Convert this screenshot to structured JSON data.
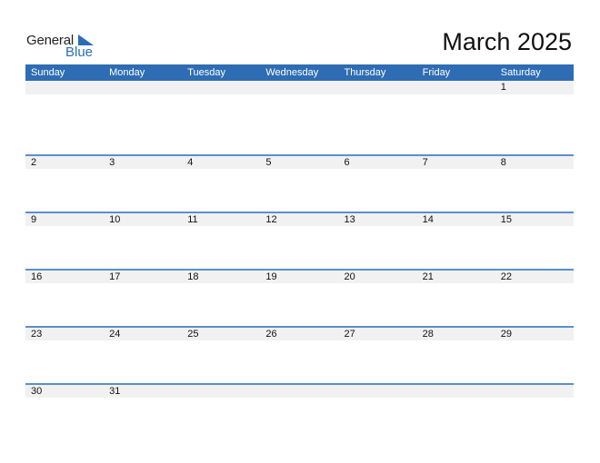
{
  "brand": {
    "word1": "General",
    "word2": "Blue",
    "color": "#2a6fb5"
  },
  "title": "March 2025",
  "header_color": "#2e6db3",
  "weekdays": [
    "Sunday",
    "Monday",
    "Tuesday",
    "Wednesday",
    "Thursday",
    "Friday",
    "Saturday"
  ],
  "weeks": [
    [
      "",
      "",
      "",
      "",
      "",
      "",
      "1"
    ],
    [
      "2",
      "3",
      "4",
      "5",
      "6",
      "7",
      "8"
    ],
    [
      "9",
      "10",
      "11",
      "12",
      "13",
      "14",
      "15"
    ],
    [
      "16",
      "17",
      "18",
      "19",
      "20",
      "21",
      "22"
    ],
    [
      "23",
      "24",
      "25",
      "26",
      "27",
      "28",
      "29"
    ],
    [
      "30",
      "31",
      "",
      "",
      "",
      "",
      ""
    ]
  ]
}
